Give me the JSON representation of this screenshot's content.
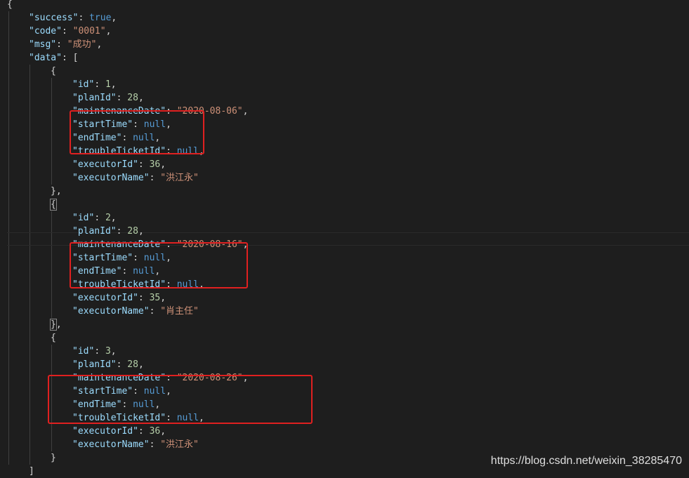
{
  "editor": {
    "background": "#1e1e1e",
    "token_colors": {
      "key": "#9cdcfe",
      "string": "#ce9178",
      "number": "#b5cea8",
      "keyword": "#569cd6",
      "punctuation": "#d4d4d4"
    },
    "highlight_color": "#e02020",
    "lines": [
      {
        "indent": 0,
        "tokens": [
          {
            "t": "punc",
            "v": "{"
          }
        ]
      },
      {
        "indent": 1,
        "tokens": [
          {
            "t": "key",
            "v": "\"success\""
          },
          {
            "t": "punc",
            "v": ": "
          },
          {
            "t": "kw",
            "v": "true"
          },
          {
            "t": "punc",
            "v": ","
          }
        ]
      },
      {
        "indent": 1,
        "tokens": [
          {
            "t": "key",
            "v": "\"code\""
          },
          {
            "t": "punc",
            "v": ": "
          },
          {
            "t": "str",
            "v": "\"0001\""
          },
          {
            "t": "punc",
            "v": ","
          }
        ]
      },
      {
        "indent": 1,
        "tokens": [
          {
            "t": "key",
            "v": "\"msg\""
          },
          {
            "t": "punc",
            "v": ": "
          },
          {
            "t": "str",
            "v": "\"成功\""
          },
          {
            "t": "punc",
            "v": ","
          }
        ]
      },
      {
        "indent": 1,
        "tokens": [
          {
            "t": "key",
            "v": "\"data\""
          },
          {
            "t": "punc",
            "v": ": ["
          }
        ]
      },
      {
        "indent": 2,
        "tokens": [
          {
            "t": "punc",
            "v": "{"
          }
        ]
      },
      {
        "indent": 3,
        "tokens": [
          {
            "t": "key",
            "v": "\"id\""
          },
          {
            "t": "punc",
            "v": ": "
          },
          {
            "t": "num",
            "v": "1"
          },
          {
            "t": "punc",
            "v": ","
          }
        ]
      },
      {
        "indent": 3,
        "tokens": [
          {
            "t": "key",
            "v": "\"planId\""
          },
          {
            "t": "punc",
            "v": ": "
          },
          {
            "t": "num",
            "v": "28"
          },
          {
            "t": "punc",
            "v": ","
          }
        ]
      },
      {
        "indent": 3,
        "tokens": [
          {
            "t": "key",
            "v": "\"maintenanceDate\""
          },
          {
            "t": "punc",
            "v": ": "
          },
          {
            "t": "str",
            "v": "\"2020-08-06\""
          },
          {
            "t": "punc",
            "v": ","
          }
        ]
      },
      {
        "indent": 3,
        "tokens": [
          {
            "t": "key",
            "v": "\"startTime\""
          },
          {
            "t": "punc",
            "v": ": "
          },
          {
            "t": "kw",
            "v": "null"
          },
          {
            "t": "punc",
            "v": ","
          }
        ]
      },
      {
        "indent": 3,
        "tokens": [
          {
            "t": "key",
            "v": "\"endTime\""
          },
          {
            "t": "punc",
            "v": ": "
          },
          {
            "t": "kw",
            "v": "null"
          },
          {
            "t": "punc",
            "v": ","
          }
        ]
      },
      {
        "indent": 3,
        "tokens": [
          {
            "t": "key",
            "v": "\"troubleTicketId\""
          },
          {
            "t": "punc",
            "v": ": "
          },
          {
            "t": "kw",
            "v": "null"
          },
          {
            "t": "punc",
            "v": ","
          }
        ]
      },
      {
        "indent": 3,
        "tokens": [
          {
            "t": "key",
            "v": "\"executorId\""
          },
          {
            "t": "punc",
            "v": ": "
          },
          {
            "t": "num",
            "v": "36"
          },
          {
            "t": "punc",
            "v": ","
          }
        ]
      },
      {
        "indent": 3,
        "tokens": [
          {
            "t": "key",
            "v": "\"executorName\""
          },
          {
            "t": "punc",
            "v": ": "
          },
          {
            "t": "str",
            "v": "\"洪江永\""
          }
        ]
      },
      {
        "indent": 2,
        "tokens": [
          {
            "t": "punc",
            "v": "},"
          }
        ]
      },
      {
        "indent": 2,
        "tokens": [
          {
            "t": "punc",
            "v": "{",
            "match": true
          }
        ]
      },
      {
        "indent": 3,
        "tokens": [
          {
            "t": "key",
            "v": "\"id\""
          },
          {
            "t": "punc",
            "v": ": "
          },
          {
            "t": "num",
            "v": "2"
          },
          {
            "t": "punc",
            "v": ","
          }
        ]
      },
      {
        "indent": 3,
        "tokens": [
          {
            "t": "key",
            "v": "\"planId\""
          },
          {
            "t": "punc",
            "v": ": "
          },
          {
            "t": "num",
            "v": "28"
          },
          {
            "t": "punc",
            "v": ","
          }
        ]
      },
      {
        "indent": 3,
        "tokens": [
          {
            "t": "key",
            "v": "\"maintenanceDate\""
          },
          {
            "t": "punc",
            "v": ": "
          },
          {
            "t": "str",
            "v": "\"2020-08-16\""
          },
          {
            "t": "punc",
            "v": ","
          }
        ]
      },
      {
        "indent": 3,
        "tokens": [
          {
            "t": "key",
            "v": "\"startTime\""
          },
          {
            "t": "punc",
            "v": ": "
          },
          {
            "t": "kw",
            "v": "null"
          },
          {
            "t": "punc",
            "v": ","
          }
        ]
      },
      {
        "indent": 3,
        "tokens": [
          {
            "t": "key",
            "v": "\"endTime\""
          },
          {
            "t": "punc",
            "v": ": "
          },
          {
            "t": "kw",
            "v": "null"
          },
          {
            "t": "punc",
            "v": ","
          }
        ]
      },
      {
        "indent": 3,
        "tokens": [
          {
            "t": "key",
            "v": "\"troubleTicketId\""
          },
          {
            "t": "punc",
            "v": ": "
          },
          {
            "t": "kw",
            "v": "null"
          },
          {
            "t": "punc",
            "v": ","
          }
        ]
      },
      {
        "indent": 3,
        "tokens": [
          {
            "t": "key",
            "v": "\"executorId\""
          },
          {
            "t": "punc",
            "v": ": "
          },
          {
            "t": "num",
            "v": "35"
          },
          {
            "t": "punc",
            "v": ","
          }
        ]
      },
      {
        "indent": 3,
        "tokens": [
          {
            "t": "key",
            "v": "\"executorName\""
          },
          {
            "t": "punc",
            "v": ": "
          },
          {
            "t": "str",
            "v": "\"肖主任\""
          }
        ]
      },
      {
        "indent": 2,
        "tokens": [
          {
            "t": "punc",
            "v": "}",
            "match": true
          },
          {
            "t": "punc",
            "v": ","
          }
        ]
      },
      {
        "indent": 2,
        "tokens": [
          {
            "t": "punc",
            "v": "{"
          }
        ]
      },
      {
        "indent": 3,
        "tokens": [
          {
            "t": "key",
            "v": "\"id\""
          },
          {
            "t": "punc",
            "v": ": "
          },
          {
            "t": "num",
            "v": "3"
          },
          {
            "t": "punc",
            "v": ","
          }
        ]
      },
      {
        "indent": 3,
        "tokens": [
          {
            "t": "key",
            "v": "\"planId\""
          },
          {
            "t": "punc",
            "v": ": "
          },
          {
            "t": "num",
            "v": "28"
          },
          {
            "t": "punc",
            "v": ","
          }
        ]
      },
      {
        "indent": 3,
        "tokens": [
          {
            "t": "key",
            "v": "\"maintenanceDate\""
          },
          {
            "t": "punc",
            "v": ": "
          },
          {
            "t": "str",
            "v": "\"2020-08-26\""
          },
          {
            "t": "punc",
            "v": ","
          }
        ]
      },
      {
        "indent": 3,
        "tokens": [
          {
            "t": "key",
            "v": "\"startTime\""
          },
          {
            "t": "punc",
            "v": ": "
          },
          {
            "t": "kw",
            "v": "null"
          },
          {
            "t": "punc",
            "v": ","
          }
        ]
      },
      {
        "indent": 3,
        "tokens": [
          {
            "t": "key",
            "v": "\"endTime\""
          },
          {
            "t": "punc",
            "v": ": "
          },
          {
            "t": "kw",
            "v": "null"
          },
          {
            "t": "punc",
            "v": ","
          }
        ]
      },
      {
        "indent": 3,
        "tokens": [
          {
            "t": "key",
            "v": "\"troubleTicketId\""
          },
          {
            "t": "punc",
            "v": ": "
          },
          {
            "t": "kw",
            "v": "null"
          },
          {
            "t": "punc",
            "v": ","
          }
        ]
      },
      {
        "indent": 3,
        "tokens": [
          {
            "t": "key",
            "v": "\"executorId\""
          },
          {
            "t": "punc",
            "v": ": "
          },
          {
            "t": "num",
            "v": "36"
          },
          {
            "t": "punc",
            "v": ","
          }
        ]
      },
      {
        "indent": 3,
        "tokens": [
          {
            "t": "key",
            "v": "\"executorName\""
          },
          {
            "t": "punc",
            "v": ": "
          },
          {
            "t": "str",
            "v": "\"洪江永\""
          }
        ]
      },
      {
        "indent": 2,
        "tokens": [
          {
            "t": "punc",
            "v": "}"
          }
        ]
      },
      {
        "indent": 1,
        "tokens": [
          {
            "t": "punc",
            "v": "]"
          }
        ]
      }
    ]
  },
  "watermark": {
    "text": "https://blog.csdn.net/weixin_38285470"
  }
}
